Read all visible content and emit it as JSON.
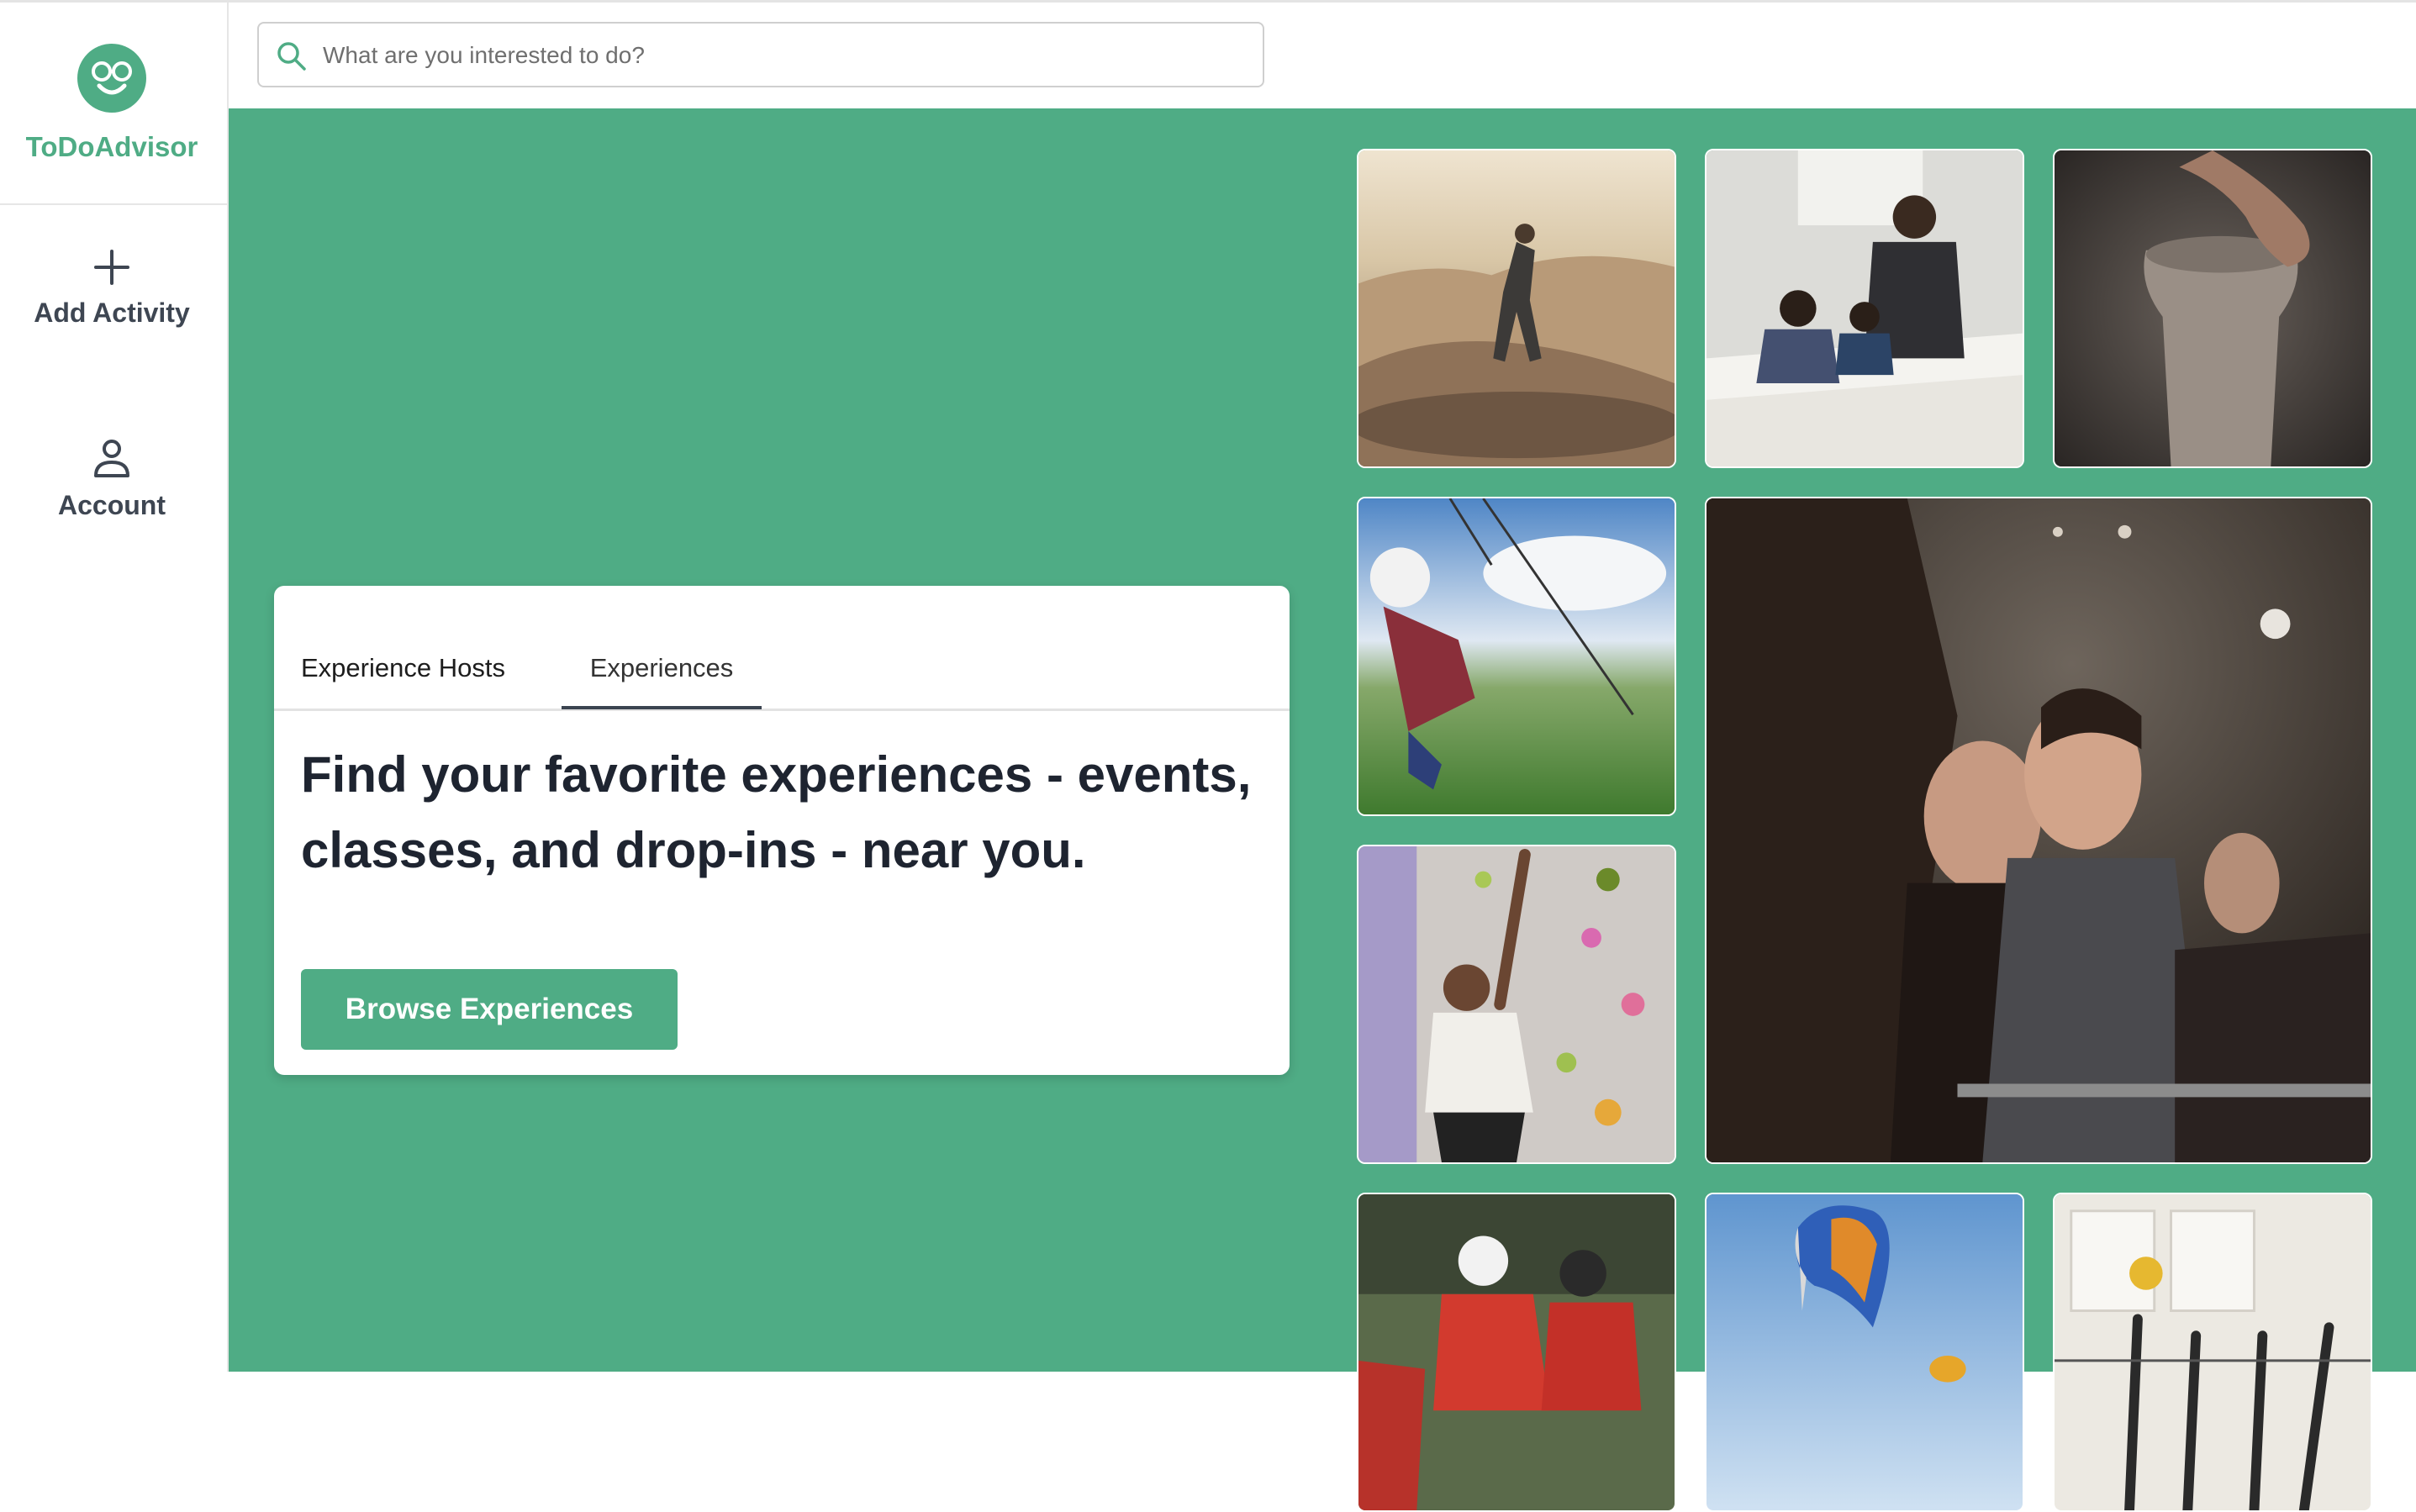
{
  "app": {
    "name": "ToDoAdvisor"
  },
  "sidebar": {
    "items": [
      {
        "label": "Add Activity",
        "icon": "plus-icon"
      },
      {
        "label": "Account",
        "icon": "person-icon"
      }
    ]
  },
  "search": {
    "placeholder": "What are you interested to do?",
    "value": ""
  },
  "hero": {
    "tabs": [
      {
        "label": "Experience Hosts",
        "active": false
      },
      {
        "label": "Experiences",
        "active": true
      }
    ],
    "headline": "Find your favorite experiences - events, classes, and drop-ins - near you.",
    "cta_label": "Browse Experiences"
  },
  "gallery": {
    "photos": [
      {
        "subject": "skateboarding",
        "icon": "skatepark-photo"
      },
      {
        "subject": "tutoring class",
        "icon": "classroom-photo"
      },
      {
        "subject": "pottery",
        "icon": "pottery-photo"
      },
      {
        "subject": "zipline",
        "icon": "zipline-photo"
      },
      {
        "subject": "concert crowd",
        "icon": "crowd-photo"
      },
      {
        "subject": "rock climbing",
        "icon": "climbing-photo"
      },
      {
        "subject": "cycling",
        "icon": "cycling-photo"
      },
      {
        "subject": "paragliding",
        "icon": "paragliding-photo"
      },
      {
        "subject": "volleyball",
        "icon": "volleyball-photo"
      }
    ]
  },
  "colors": {
    "brand": "#4fac85",
    "text_dark": "#1e2430",
    "nav_text": "#3e4652"
  }
}
